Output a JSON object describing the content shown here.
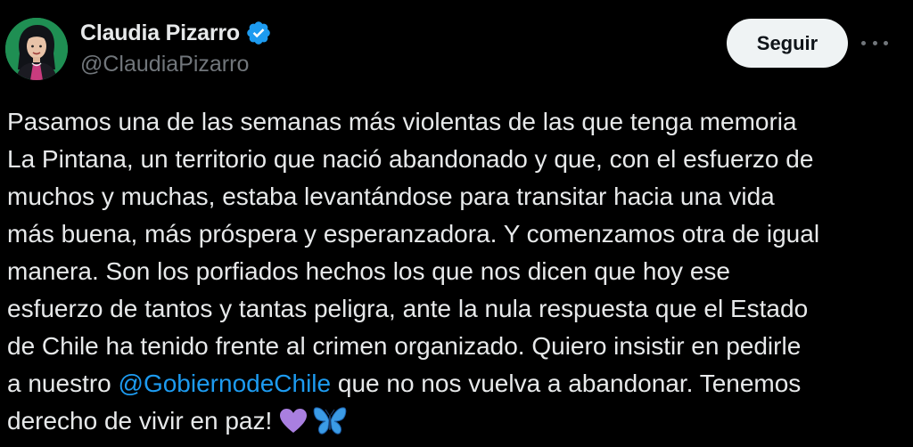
{
  "author": {
    "display_name": "Claudia Pizarro",
    "handle": "@ClaudiaPizarro",
    "verified": true,
    "avatar_icon": "avatar-portrait-icon"
  },
  "actions": {
    "follow_label": "Seguir",
    "more_icon": "more-options-icon"
  },
  "tweet": {
    "lines": [
      "Pasamos una de las semanas más violentas de las que tenga memoria",
      "La Pintana, un territorio que nació abandonado y que, con el esfuerzo de",
      "muchos y muchas, estaba levantándose para transitar hacia una vida",
      "más buena, más próspera y esperanzadora. Y comenzamos otra de igual",
      "manera. Son los porfiados hechos los que nos dicen que hoy ese",
      "esfuerzo de tantos y tantas peligra, ante la nula respuesta que el Estado",
      "de Chile ha tenido frente al crimen organizado. Quiero insistir en pedirle"
    ],
    "line8_before": "a nuestro ",
    "mention": "@GobiernodeChile",
    "line8_after": " que no nos vuelva a abandonar. Tenemos",
    "line9": "derecho de vivir en paz!",
    "emojis": [
      "purple-heart-icon",
      "butterfly-icon"
    ]
  },
  "colors": {
    "background": "#000000",
    "text": "#e7e9ea",
    "secondary_text": "#71767b",
    "link": "#1d9bf0",
    "verified_badge": "#1d9bf0",
    "follow_button_bg": "#eff3f4"
  }
}
